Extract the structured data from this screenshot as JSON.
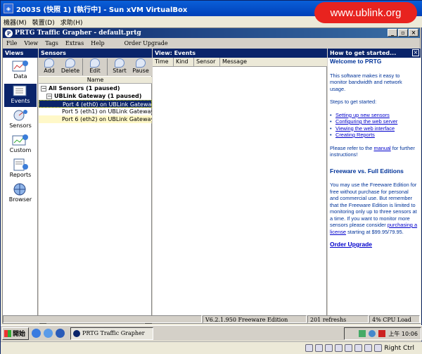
{
  "vbox": {
    "title": "2003S (快照 1) [執行中] - Sun xVM VirtualBox",
    "menu": [
      "機器(M)",
      "裝置(D)",
      "求助(H)"
    ],
    "brand": "www.ublink.org",
    "hostkey": "Right Ctrl"
  },
  "app": {
    "title": "PRTG Traffic Grapher - default.prtg",
    "menu": [
      "File",
      "View",
      "Tags",
      "Extras",
      "Help"
    ],
    "order_upgrade": "Order Upgrade"
  },
  "views": {
    "header": "Views",
    "items": [
      "Data",
      "Events",
      "Sensors",
      "Custom",
      "Reports",
      "Browser"
    ],
    "selected": "Events"
  },
  "sensors": {
    "header": "Sensors",
    "toolbar": [
      "Add",
      "Delete",
      "Edit",
      "Start",
      "Pause"
    ],
    "column": "Name",
    "root": "All Sensors (1 paused)",
    "group": "UBLink Gateway (1 paused)",
    "ports": [
      "Port 4 (eth0) on UBLink Gateway",
      "Port 5 (eth1) on UBLink Gateway",
      "Port 6 (eth2) on UBLink Gateway"
    ]
  },
  "events": {
    "header": "View: Events",
    "columns": [
      "Time",
      "Kind",
      "Sensor",
      "Message"
    ]
  },
  "help": {
    "header": "How to get started...",
    "welcome": "Welcome to PRTG",
    "intro": "This software makes it easy to monitor bandwidth and network usage.",
    "steps_title": "Steps to get started:",
    "steps": [
      "Setting up new sensors",
      "Configuring the web server",
      "Viewing the web interface",
      "Creating Reports"
    ],
    "refer_pre": "Please refer to the ",
    "refer_link": "manual",
    "refer_post": " for further instructions!",
    "fvf": "Freeware vs. Full Editions",
    "fvf_text": "You may use the Freeware Edition for free without purchase for personal and commercial use. But remember that the Freeware Edition is limited to monitoring only up to three sensors at a time. If you want to monitor more sensors please consider ",
    "fvf_link": "purchasing a license",
    "fvf_post": " starting at $99.95/79.95.",
    "order": "Order Upgrade"
  },
  "status": {
    "version": "V6.2.1.950 Freeware Edition",
    "refreshs": "201 refreshs",
    "cpu": "4% CPU Load"
  },
  "taskbar": {
    "start": "開始",
    "task": "PRTG Traffic Grapher",
    "clock": "上午 10:06"
  }
}
